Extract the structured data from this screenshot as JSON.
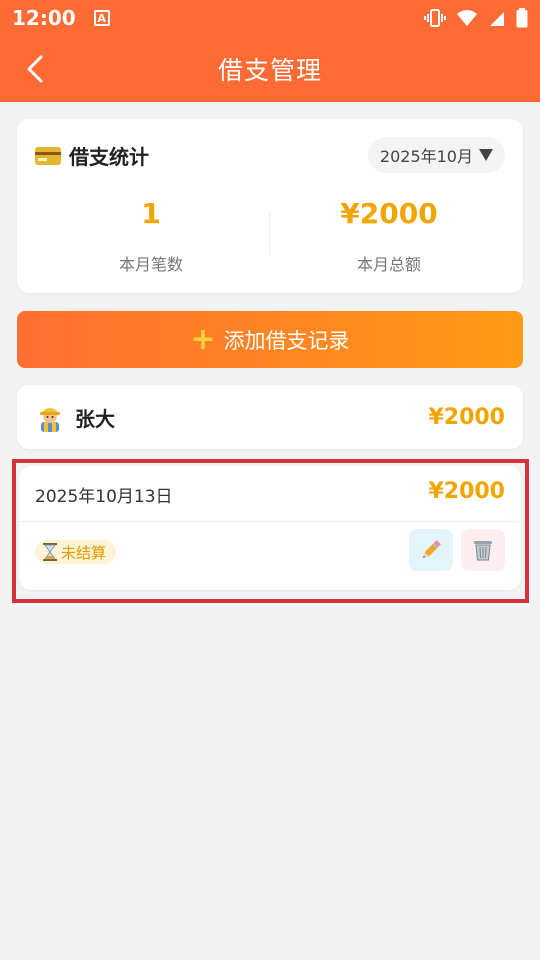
{
  "status_bar": {
    "time": "12:00",
    "notif_letter": "A"
  },
  "header": {
    "title": "借支管理"
  },
  "stats": {
    "title": "借支统计",
    "month": "2025年10月",
    "count_value": "1",
    "count_label": "本月笔数",
    "total_value": "¥2000",
    "total_label": "本月总额"
  },
  "add_button": {
    "label": "添加借支记录"
  },
  "person": {
    "name": "张大",
    "amount": "¥2000"
  },
  "record": {
    "date": "2025年10月13日",
    "amount": "¥2000",
    "status": "未结算"
  },
  "colors": {
    "header": "#ff6b35",
    "accent": "#f0a500",
    "highlight": "#d6323c"
  },
  "icons": [
    "back-arrow",
    "credit-card",
    "chevron-down",
    "plus",
    "construction-worker",
    "hourglass",
    "pencil",
    "wastebasket"
  ]
}
